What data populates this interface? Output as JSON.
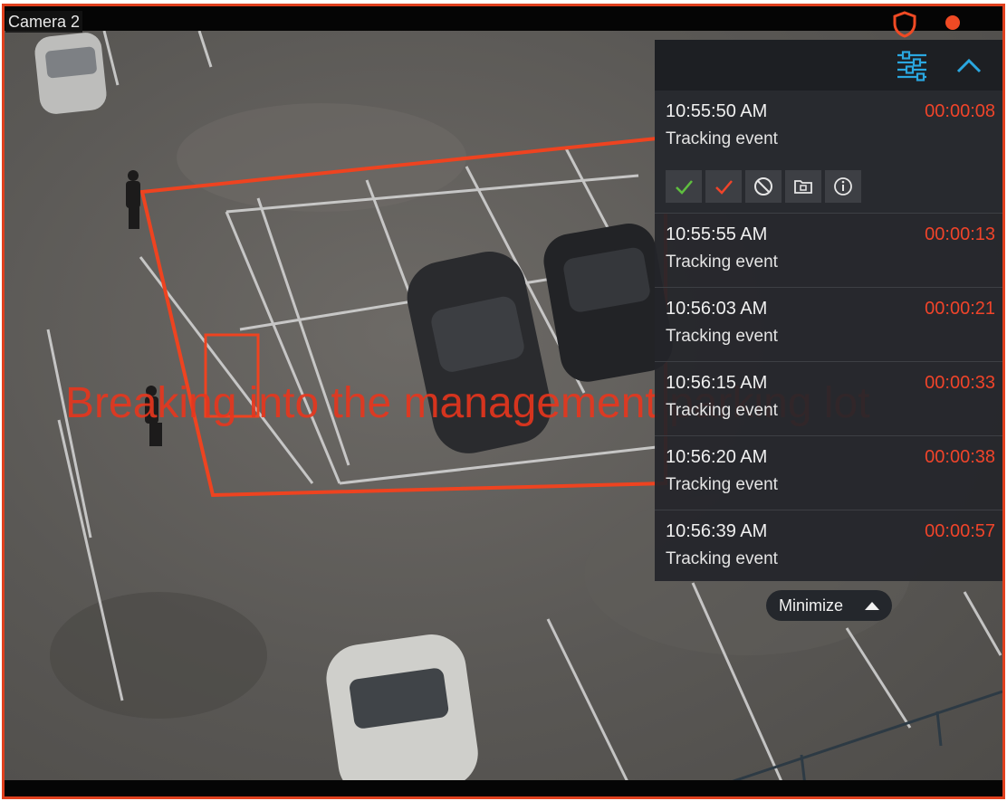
{
  "camera": {
    "title": "Camera 2"
  },
  "overlay": {
    "text": "Breaking into the management parking lot"
  },
  "colors": {
    "frame": "#e0401e",
    "accent": "#2aa7e0",
    "alarm": "#f0442a",
    "confirm_green": "#5fbf3f"
  },
  "icons": {
    "header_left": "shield-icon",
    "recording": "record-dot-icon",
    "filter": "filter-sliders-icon",
    "collapse": "chevron-up-icon",
    "actions": [
      "check-icon",
      "check-red-icon",
      "ban-icon",
      "folder-camera-icon",
      "info-icon"
    ]
  },
  "events": [
    {
      "time": "10:55:50 AM",
      "type": "Tracking event",
      "duration": "00:00:08"
    },
    {
      "time": "10:55:55 AM",
      "type": "Tracking event",
      "duration": "00:00:13"
    },
    {
      "time": "10:56:03 AM",
      "type": "Tracking event",
      "duration": "00:00:21"
    },
    {
      "time": "10:56:15 AM",
      "type": "Tracking event",
      "duration": "00:00:33"
    },
    {
      "time": "10:56:20 AM",
      "type": "Tracking event",
      "duration": "00:00:38"
    },
    {
      "time": "10:56:39 AM",
      "type": "Tracking event",
      "duration": "00:00:57"
    }
  ],
  "minimize": {
    "label": "Minimize"
  }
}
